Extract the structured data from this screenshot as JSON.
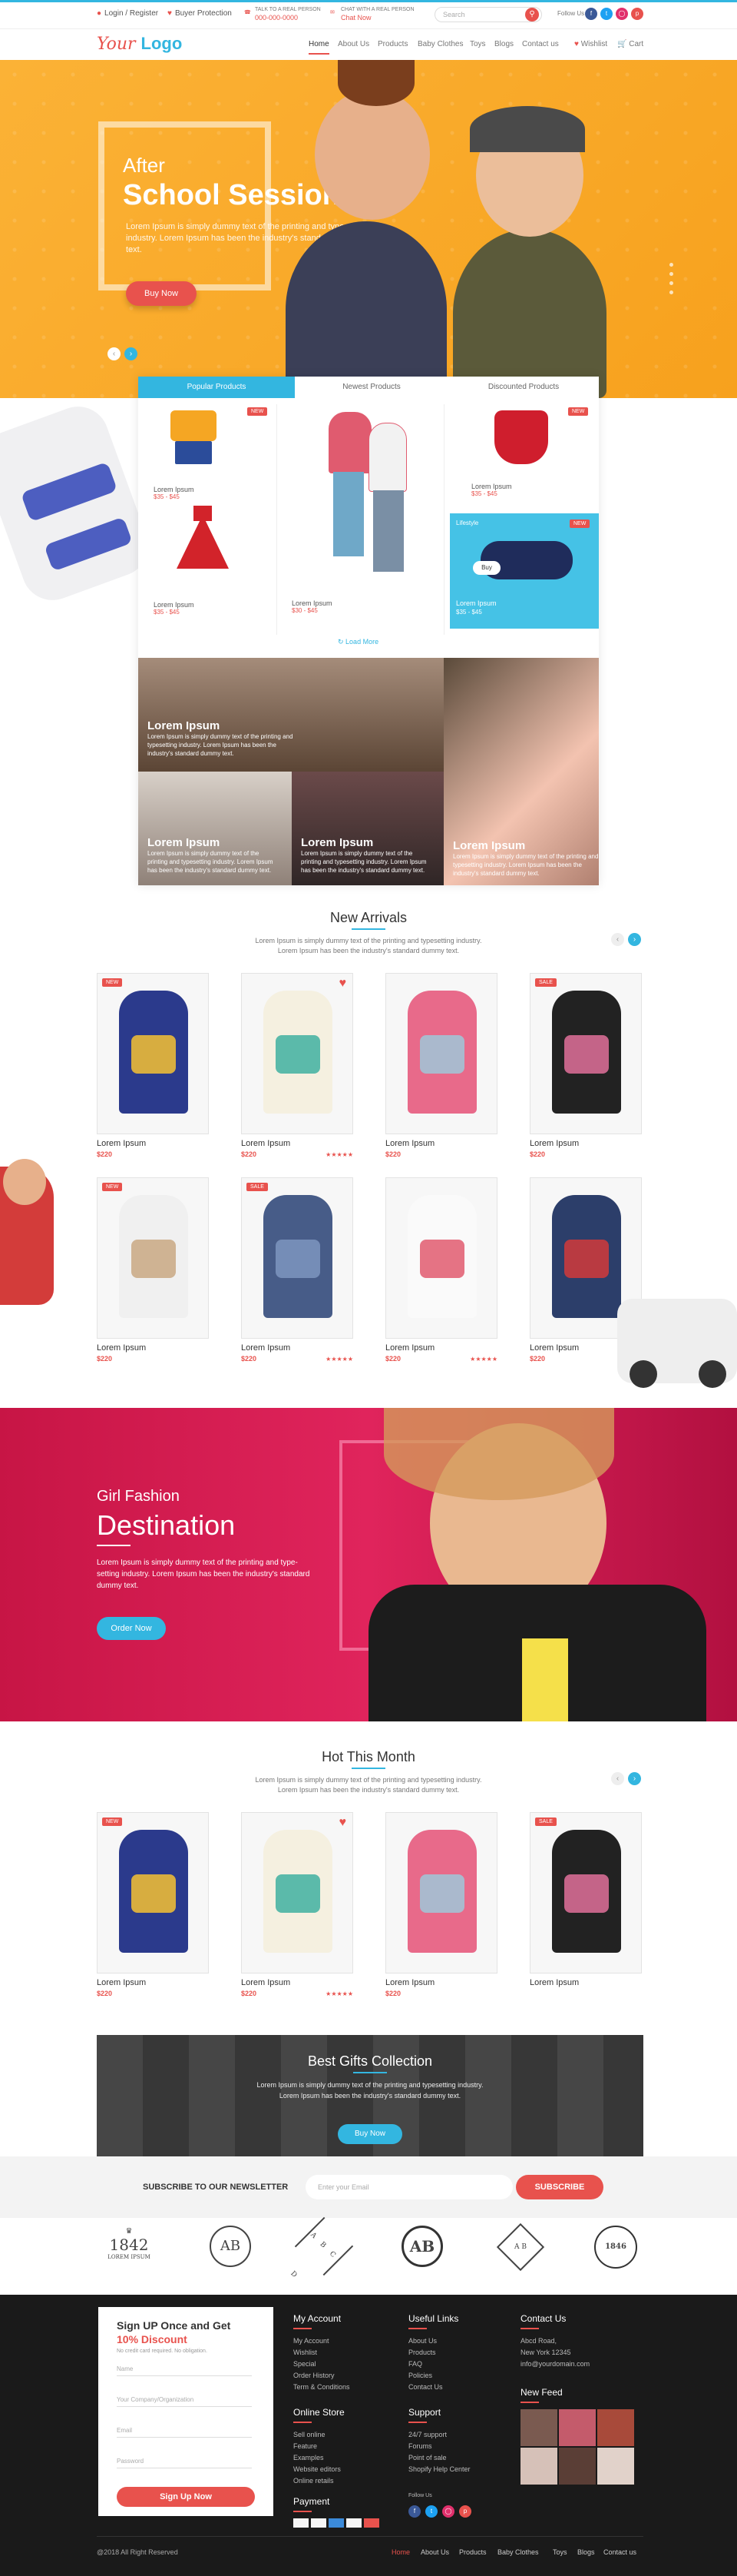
{
  "topbar": {
    "login": "Login / Register",
    "protection": "Buyer Protection",
    "talk_label": "TALK TO A REAL PERSON",
    "phone": "000-000-0000",
    "chat_label": "CHAT WITH A REAL PERSON",
    "chat_now": "Chat Now",
    "search_placeholder": "Search",
    "follow": "Follow Us"
  },
  "logo": {
    "your": "Your",
    "logo": "Logo"
  },
  "nav": {
    "items": [
      "Home",
      "About Us",
      "Products",
      "Baby Clothes",
      "Toys",
      "Blogs",
      "Contact us"
    ],
    "wishlist": "Wishlist",
    "cart": "Cart"
  },
  "hero": {
    "line1": "After",
    "line2": "School Session",
    "text": "Lorem Ipsum is simply dummy text of the printing and typesetting industry. Lorem Ipsum has been the industry's standard dummy text.",
    "button": "Buy Now"
  },
  "tabs": {
    "labels": [
      "Popular Products",
      "Newest Products",
      "Discounted Products"
    ],
    "new_badge": "NEW",
    "product_name": "Lorem Ipsum",
    "price": "$35 - $45",
    "price_b": "$30 - $45",
    "lifestyle": "Lifestyle",
    "buy": "Buy",
    "load_more": "Load More"
  },
  "gallery": {
    "title": "Lorem Ipsum",
    "text": "Lorem Ipsum is simply dummy text of the printing and typesetting industry. Lorem Ipsum has been the industry's standard dummy text."
  },
  "new_arrivals": {
    "title": "New Arrivals",
    "sub1": "Lorem Ipsum is simply dummy text of the printing and typesetting industry.",
    "sub2": "Lorem Ipsum has been the industry's standard dummy text.",
    "products": [
      {
        "name": "Lorem Ipsum",
        "price": "$220",
        "badge": "NEW",
        "stars": ""
      },
      {
        "name": "Lorem Ipsum",
        "price": "$220",
        "badge": "",
        "stars": "★★★★★"
      },
      {
        "name": "Lorem Ipsum",
        "price": "$220",
        "badge": "",
        "stars": ""
      },
      {
        "name": "Lorem Ipsum",
        "price": "$220",
        "badge": "SALE",
        "stars": ""
      },
      {
        "name": "Lorem Ipsum",
        "price": "$220",
        "badge": "NEW",
        "stars": ""
      },
      {
        "name": "Lorem Ipsum",
        "price": "$220",
        "badge": "SALE",
        "stars": "★★★★★"
      },
      {
        "name": "Lorem Ipsum",
        "price": "$220",
        "badge": "",
        "stars": "★★★★★"
      },
      {
        "name": "Lorem Ipsum",
        "price": "$220",
        "badge": "",
        "stars": ""
      }
    ]
  },
  "fashion": {
    "line1": "Girl Fashion",
    "line2": "Destination",
    "text": "Lorem Ipsum is simply dummy text of the printing and type-setting industry. Lorem Ipsum has been the industry's standard dummy text.",
    "button": "Order Now"
  },
  "hot": {
    "title": "Hot This Month",
    "sub1": "Lorem Ipsum is simply dummy text of the printing and typesetting industry.",
    "sub2": "Lorem Ipsum has been the industry's standard dummy text.",
    "products": [
      {
        "name": "Lorem Ipsum",
        "price": "$220",
        "badge": "NEW",
        "stars": ""
      },
      {
        "name": "Lorem Ipsum",
        "price": "$220",
        "badge": "",
        "stars": "★★★★★"
      },
      {
        "name": "Lorem Ipsum",
        "price": "$220",
        "badge": "",
        "stars": ""
      },
      {
        "name": "Lorem Ipsum",
        "price": "",
        "badge": "SALE",
        "stars": ""
      }
    ]
  },
  "gifts": {
    "title": "Best Gifts Collection",
    "text1": "Lorem Ipsum is simply dummy text of the printing and typesetting industry.",
    "text2": "Lorem Ipsum has been the industry's standard dummy text.",
    "button": "Buy Now"
  },
  "newsletter": {
    "label": "SUBSCRIBE TO OUR NEWSLETTER",
    "placeholder": "Enter your Email",
    "button": "SUBSCRIBE"
  },
  "brands": {
    "b1_year": "1842",
    "b1_sub": "LOREM IPSUM",
    "b2": "AB",
    "b3": "A B C D",
    "b4": "AB",
    "b5": "A B",
    "b6": "1846"
  },
  "footer": {
    "form_title1": "Sign UP Once and Get",
    "form_title2": "10% Discount",
    "form_note": "No credit card required. No obligation.",
    "fields": [
      "Name",
      "Your Company/Organization",
      "Email",
      "Password"
    ],
    "form_button": "Sign Up Now",
    "account_title": "My Account",
    "account_items": [
      "My Account",
      "Wishlist",
      "Special",
      "Order History",
      "Term & Conditions"
    ],
    "links_title": "Useful Links",
    "links_items": [
      "About Us",
      "Products",
      "FAQ",
      "Policies",
      "Contact Us"
    ],
    "contact_title": "Contact Us",
    "contact_items": [
      "Abcd Road,",
      "New York 12345",
      "info@yourdomain.com"
    ],
    "store_title": "Online Store",
    "store_items": [
      "Sell online",
      "Feature",
      "Examples",
      "Website editors",
      "Online retails"
    ],
    "support_title": "Support",
    "support_items": [
      "24/7 support",
      "Forums",
      "Point of sale",
      "Shopify Help Center"
    ],
    "feed_title": "New Feed",
    "payment_title": "Payment",
    "follow": "Follow Us",
    "copyright": "@2018 All Right Reserved",
    "bottom_nav": [
      "Home",
      "About Us",
      "Products",
      "Baby Clothes",
      "Toys",
      "Blogs",
      "Contact us"
    ]
  },
  "colors": {
    "accent": "#e8524d",
    "secondary": "#33b6e0",
    "hero": "#fbb236",
    "fashion": "#d81b50",
    "footer": "#1a1a1a"
  }
}
